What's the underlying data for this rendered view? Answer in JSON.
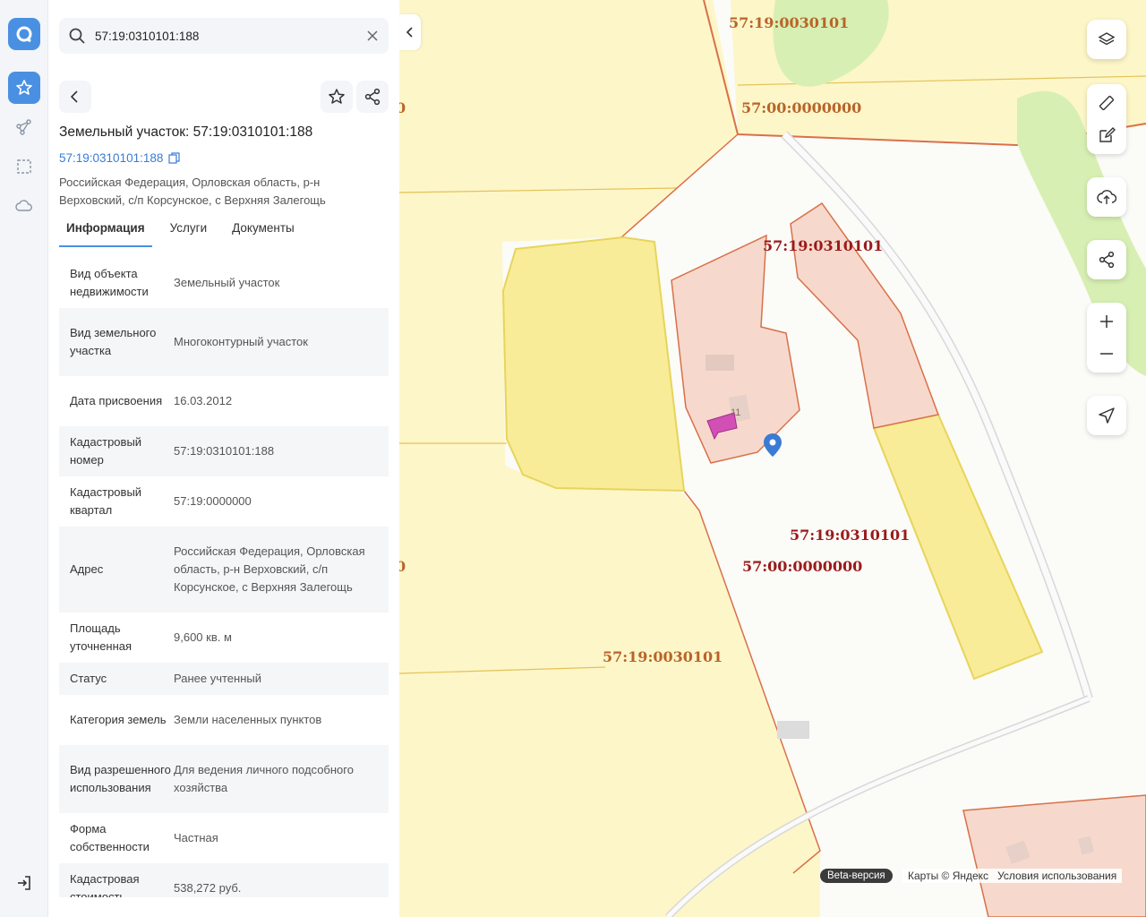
{
  "search": {
    "value": "57:19:0310101:188"
  },
  "object": {
    "title": "Земельный участок: 57:19:0310101:188",
    "cad_number": "57:19:0310101:188",
    "address": "Российская Федерация, Орловская область, р-н Верховский, с/п Корсунское, с Верхняя Залегощь"
  },
  "tabs": [
    {
      "label": "Информация"
    },
    {
      "label": "Услуги"
    },
    {
      "label": "Документы"
    }
  ],
  "info_rows": [
    {
      "key": "Вид объекта недвижимости",
      "value": "Земельный участок"
    },
    {
      "key": "Вид земельного участка",
      "value": "Многоконтурный участок"
    },
    {
      "key": "Дата присвоения",
      "value": "16.03.2012"
    },
    {
      "key": "Кадастровый номер",
      "value": "57:19:0310101:188"
    },
    {
      "key": "Кадастровый квартал",
      "value": "57:19:0000000"
    },
    {
      "key": "Адрес",
      "value": "Российская Федерация, Орловская область, р-н Верховский, с/п Корсунское, с Верхняя Залегощь"
    },
    {
      "key": "Площадь уточненная",
      "value": "9,600 кв. м"
    },
    {
      "key": "Статус",
      "value": "Ранее учтенный"
    },
    {
      "key": "Категория земель",
      "value": "Земли населенных пунктов"
    },
    {
      "key": "Вид разрешенного использования",
      "value": "Для ведения личного подсобного хозяйства"
    },
    {
      "key": "Форма собственности",
      "value": "Частная"
    },
    {
      "key": "Кадастровая стоимость",
      "value": "538,272 руб."
    }
  ],
  "map": {
    "labels": [
      {
        "text": "57:19:0030101",
        "color": "#b8642a"
      },
      {
        "text": "57:00:0000000",
        "color": "#b8642a"
      },
      {
        "text": "57:19:0310101",
        "color": "#9a1a1a"
      },
      {
        "text": "57:19:0310101",
        "color": "#9a1a1a"
      },
      {
        "text": "57:00:0000000",
        "color": "#9a1a1a"
      },
      {
        "text": "57:19:0030101",
        "color": "#b8642a"
      },
      {
        "text": "0",
        "color": "#b8642a"
      },
      {
        "text": "0",
        "color": "#b8642a"
      }
    ],
    "house_number": "11",
    "beta_label": "Beta-версия",
    "copyright": "Карты © Яндекс",
    "terms": "Условия использования"
  },
  "colors": {
    "accent": "#4a90e2",
    "parcel_yellow": "#fbf0a6",
    "parcel_pink": "#f6d9cc",
    "selected": "#d24fb5"
  }
}
